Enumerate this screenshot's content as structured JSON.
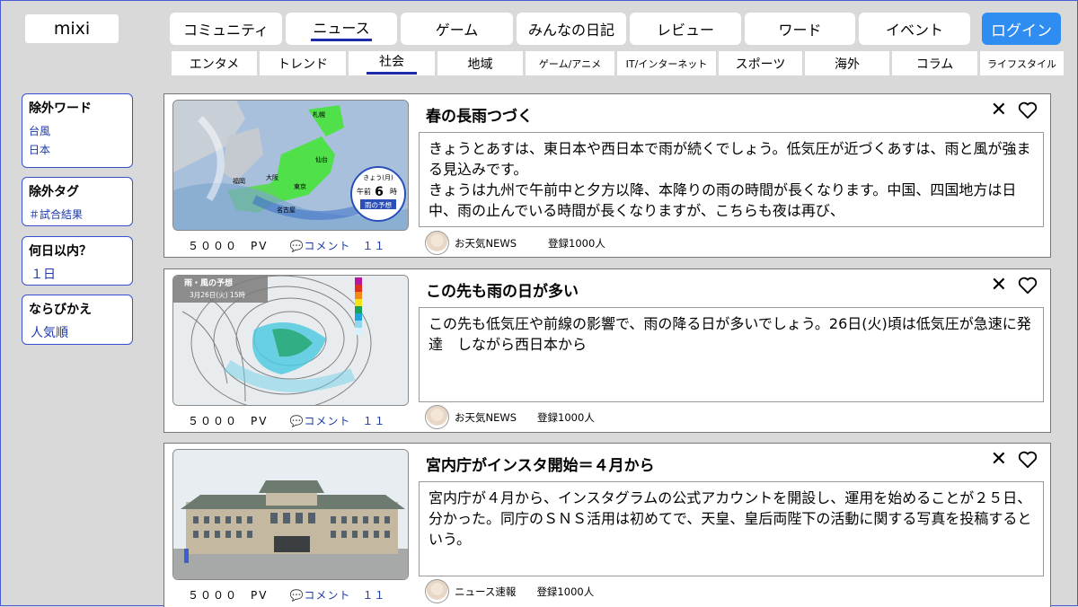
{
  "logo": "mixi",
  "nav": {
    "tabs": [
      "コミュニティ",
      "ニュース",
      "ゲーム",
      "みんなの日記",
      "レビュー",
      "ワード",
      "イベント"
    ],
    "login": "ログイン",
    "subtabs": [
      "エンタメ",
      "トレンド",
      "社会",
      "地域",
      "ゲーム/アニメ",
      "IT/インターネット",
      "スポーツ",
      "海外",
      "コラム",
      "ライフスタイル"
    ]
  },
  "sidebar": {
    "exclude_words": {
      "title": "除外ワード",
      "items": [
        "台風",
        "日本"
      ]
    },
    "exclude_tags": {
      "title": "除外タグ",
      "items": [
        "＃試合結果"
      ]
    },
    "days": {
      "title": "何日以内？",
      "value": "１日"
    },
    "sort": {
      "title": "ならびかえ",
      "value": "人気順"
    }
  },
  "articles": [
    {
      "title": "春の長雨つづく",
      "body": "きょうとあすは、東日本や西日本で雨が続くでしょう。低気圧が近づくあすは、雨と風が強まる見込みです。\nきょうは九州で午前中と夕方以降、本降りの雨の時間が長くなります。中国、四国地方は日中、雨の止んでいる時間が長くなりますが、こちらも夜は再び、",
      "pv": "５０００　PV",
      "comments": "コメント　１１",
      "author": "お天気NEWS",
      "registered": "登録1000人",
      "map_badge": {
        "line1": "きょう(月)",
        "line2": "午前",
        "num": "6",
        "unit": "時",
        "label": "雨の予想"
      },
      "map_labels": [
        "札幌",
        "仙台",
        "大阪",
        "東京",
        "福岡",
        "名古屋"
      ]
    },
    {
      "title": "この先も雨の日が多い",
      "body": "この先も低気圧や前線の影響で、雨の降る日が多いでしょう。26日(火)頃は低気圧が急速に発達　しながら西日本から",
      "pv": "５０００　PV",
      "comments": "コメント　１１",
      "author": "お天気NEWS",
      "registered": "登録1000人",
      "map_title": "雨・風の予想",
      "map_date": "3月26日(火) 15時"
    },
    {
      "title": "宮内庁がインスタ開始＝４月から",
      "body": "宮内庁が４月から、インスタグラムの公式アカウントを開設し、運用を始めることが２５日、分かった。同庁のＳＮＳ活用は初めてで、天皇、皇后両陛下の活動に関する写真を投稿するという。",
      "pv": "５０００　PV",
      "comments": "コメント　１１",
      "author": "ニュース速報",
      "registered": "登録1000人"
    }
  ]
}
